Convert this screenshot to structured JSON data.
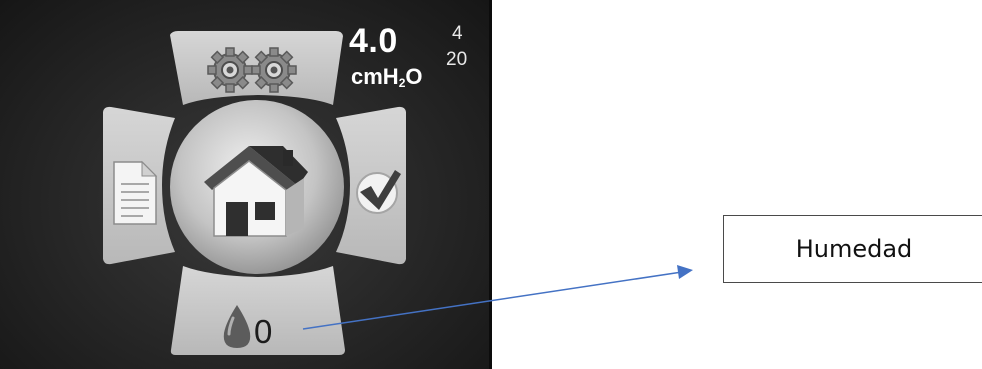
{
  "device_screen": {
    "pressure_value": "4.0",
    "pressure_unit_main": "cmH",
    "pressure_unit_sub": "2",
    "pressure_unit_tail": "O",
    "side_value_top": "4",
    "side_value_bottom": "20",
    "humidity_value": "0",
    "menu": {
      "top": "settings-gears-icon",
      "left": "report-document-icon",
      "center": "home-icon",
      "right": "check-icon",
      "bottom": "humidity-drop-icon"
    },
    "colors": {
      "panel": "#c9c9c9",
      "background": "#262626",
      "text": "#ffffff"
    }
  },
  "callout": {
    "label": "Humedad",
    "arrow_color": "#4472c4"
  }
}
